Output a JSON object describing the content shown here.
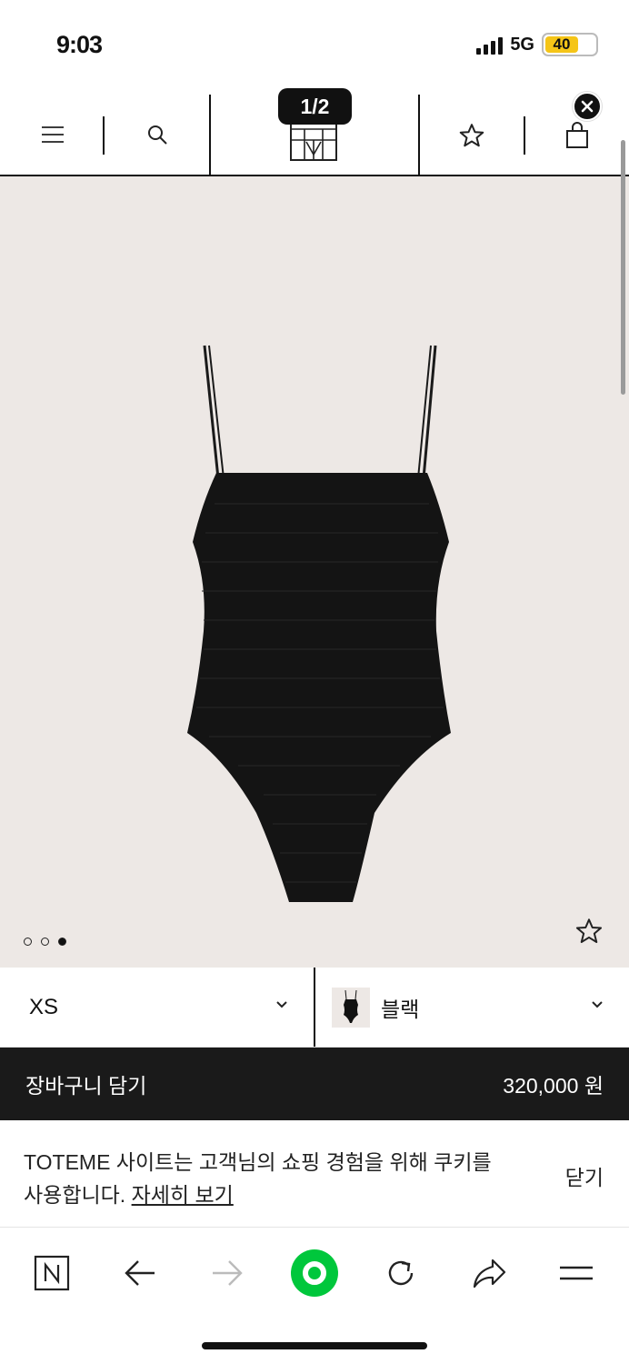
{
  "status_bar": {
    "time": "9:03",
    "network": "5G",
    "battery": "40"
  },
  "viewer": {
    "page_counter": "1/2"
  },
  "header": {
    "logo_label": "TOTEME"
  },
  "product": {
    "gallery_dots": 3,
    "active_dot": 3
  },
  "selectors": {
    "size": "XS",
    "color": "블랙"
  },
  "cart": {
    "label": "장바구니 담기",
    "price": "320,000 원"
  },
  "cookie_banner": {
    "text": "TOTEME 사이트는 고객님의 쇼핑 경험을 위해 쿠키를 사용합니다.",
    "link": "자세히 보기",
    "close": "닫기"
  },
  "toolbar": {
    "items": [
      "naver-home",
      "back",
      "forward",
      "green-dot",
      "reload",
      "share",
      "menu"
    ]
  },
  "colors": {
    "cart_bar": "#1a1a1a",
    "image_bg": "#ede8e5",
    "battery": "#f5c518",
    "green_button": "#00c73c"
  }
}
